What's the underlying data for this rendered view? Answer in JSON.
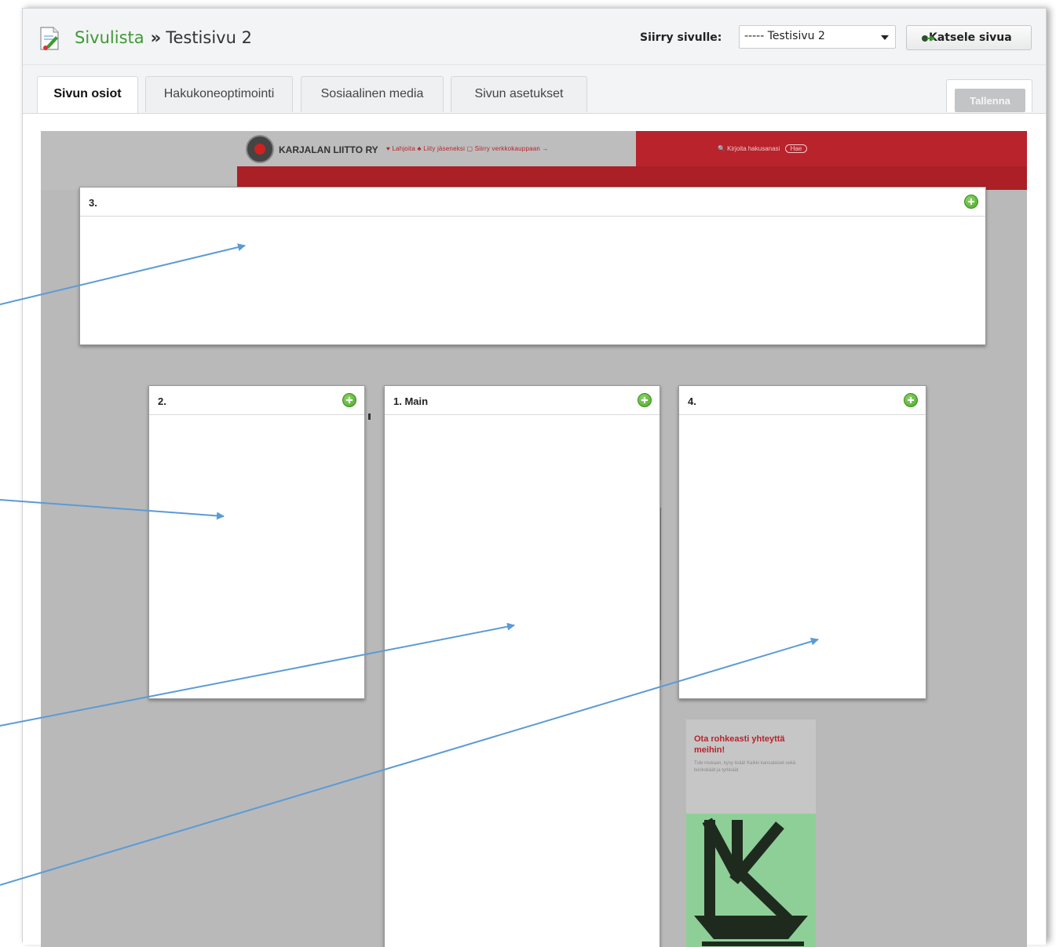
{
  "header": {
    "breadcrumb_root": "Sivulista",
    "breadcrumb_sep": "»",
    "breadcrumb_current": "Testisivu 2",
    "goto_label": "Siirry sivulle:",
    "goto_value": "----- Testisivu 2",
    "view_button": "Katsele sivua"
  },
  "tabs": [
    {
      "label": "Sivun osiot",
      "active": true
    },
    {
      "label": "Hakukoneoptimointi",
      "active": false
    },
    {
      "label": "Sosiaalinen media",
      "active": false
    },
    {
      "label": "Sivun asetukset",
      "active": false
    }
  ],
  "save_button": "Tallenna",
  "preview": {
    "site_title": "KARJALAN LIITTO RY",
    "site_links": "♥ Lahjoita    ♣ Liity jäseneksi    ▢ Siirry verkkokauppaan →",
    "site_search": "🔍 Kirjoita hakusanasi",
    "site_search_button": "Hae",
    "promo_title": "Ota rohkeasti yhteyttä meihin!",
    "promo_text": "Tule mukaan, kysy lisää! Kaikki kansalaiset sekä teinkokäät ja tyrkkäät"
  },
  "sections": [
    {
      "label": "3."
    },
    {
      "label": "2."
    },
    {
      "label": "1. Main"
    },
    {
      "label": "4."
    }
  ],
  "colors": {
    "brand_red": "#b8232c",
    "link_green": "#3d9a34",
    "arrow_blue": "#5b9bd5",
    "add_green": "#4aa52b"
  }
}
